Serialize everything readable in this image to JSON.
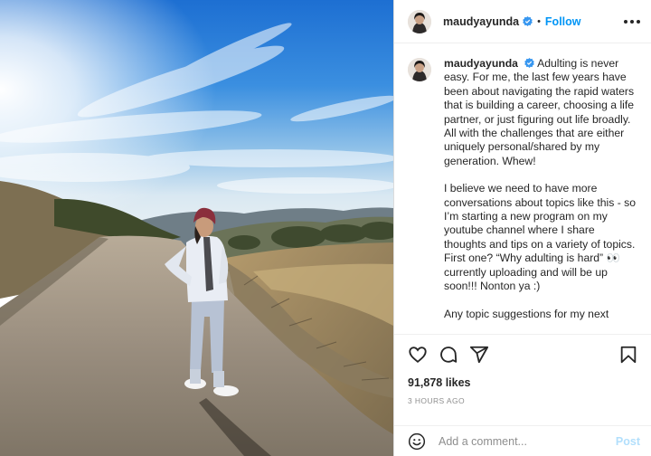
{
  "post": {
    "username": "maudyayunda",
    "verified_icon": "verified-badge-icon",
    "separator": "•",
    "follow_label": "Follow",
    "more_icon": "more-options-icon"
  },
  "caption": {
    "username": "maudyayunda",
    "paragraph1": "Adulting is never easy. For me, the last few years have been about navigating the rapid waters that is building a career, choosing a life partner, or just figuring out life broadly. All with the challenges that are either uniquely personal/shared by my generation. Whew!",
    "paragraph2": "I believe we need to have more conversations about topics like this - so I’m starting a new program on my youtube channel where I share thoughts and tips on a variety of topics. First one? “Why adulting is hard” 👀 currently uploading and will be up soon!!! Nonton ya :)",
    "paragraph3": "Any topic suggestions for my next"
  },
  "actions": {
    "like_icon": "heart-icon",
    "comment_icon": "comment-icon",
    "share_icon": "share-icon",
    "save_icon": "bookmark-icon"
  },
  "likes": "91,878 likes",
  "timestamp": "3 hours ago",
  "comment_box": {
    "emoji_icon": "emoji-icon",
    "placeholder": "Add a comment...",
    "post_label": "Post"
  },
  "colors": {
    "accent": "#0095f6",
    "post_disabled": "#b2dffc",
    "text": "#262626",
    "muted": "#8e8e8e",
    "verified": "#3897f0"
  }
}
